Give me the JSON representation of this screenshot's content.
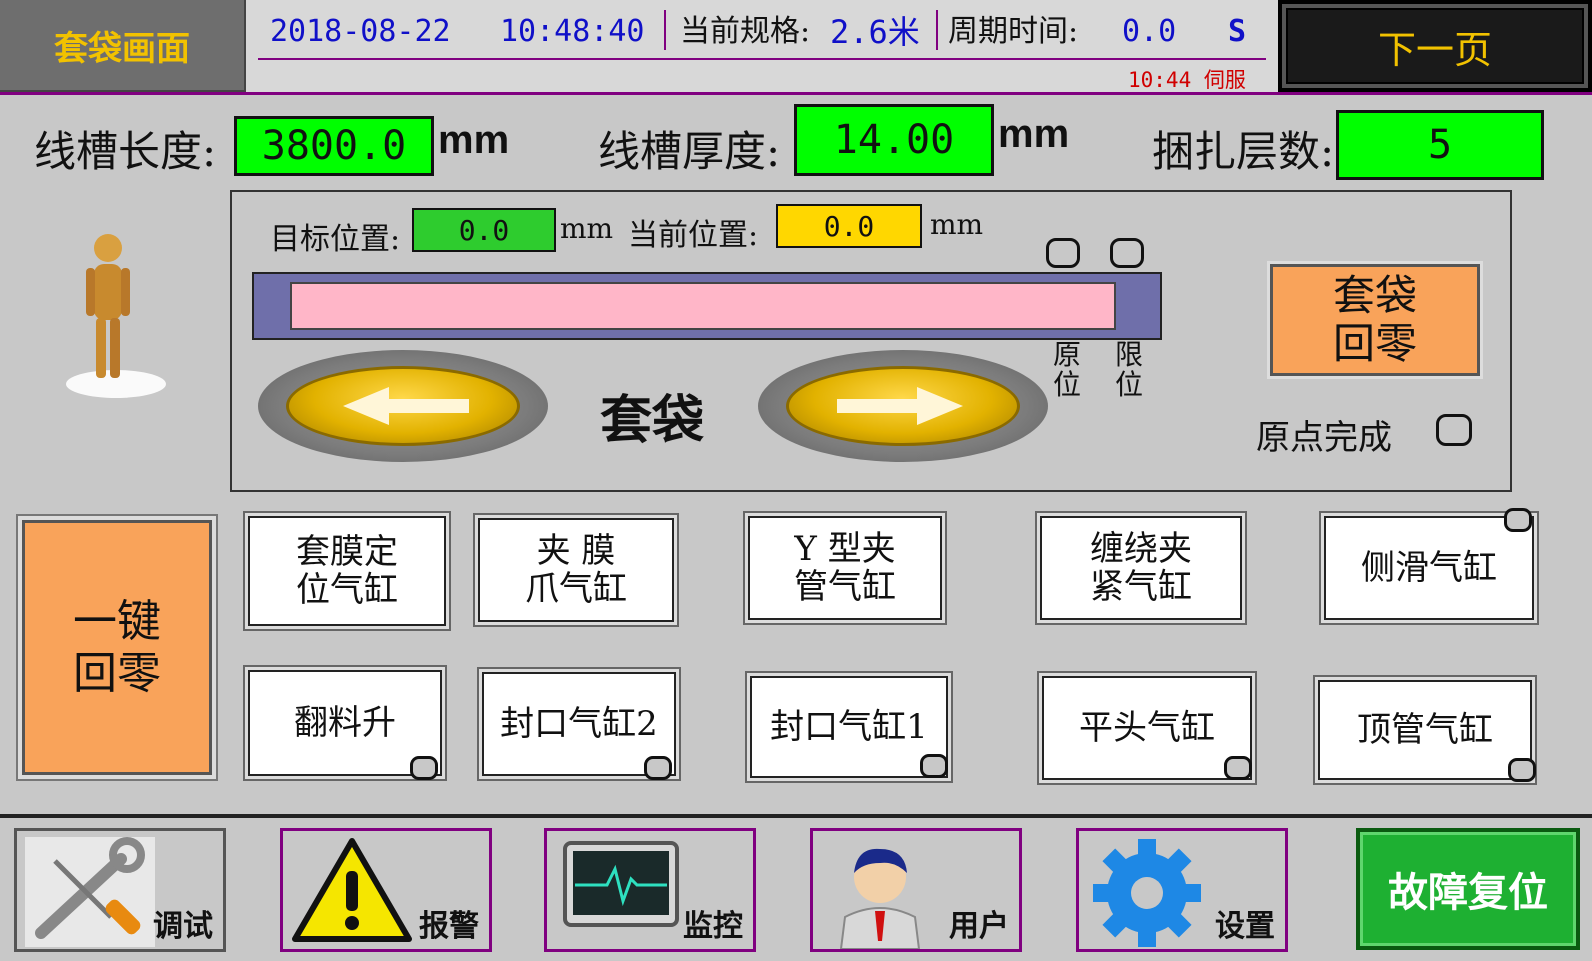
{
  "header": {
    "screen_title": "套袋画面",
    "date": "2018-08-22",
    "time": "10:48:40",
    "spec_label": "当前规格:",
    "spec_value": "2.6米",
    "cycle_label": "周期时间:",
    "cycle_value": "0.0",
    "cycle_unit": "S",
    "servo_message": "10:44 伺服",
    "next_page_label": "下一页"
  },
  "params": {
    "slot_length_label": "线槽长度:",
    "slot_length_value": "3800.0",
    "slot_length_unit": "mm",
    "slot_thickness_label": "线槽厚度:",
    "slot_thickness_value": "14.00",
    "slot_thickness_unit": "mm",
    "bind_layers_label": "捆扎层数:",
    "bind_layers_value": "5"
  },
  "position": {
    "target_label": "目标位置:",
    "target_value": "0.0",
    "target_unit": "mm",
    "current_label": "当前位置:",
    "current_value": "0.0",
    "current_unit": "mm",
    "origin_label": "原位",
    "limit_label": "限位",
    "jog_label": "套袋",
    "bag_zero_label_1": "套袋",
    "bag_zero_label_2": "回零",
    "origin_done_label": "原点完成"
  },
  "one_key_zero": {
    "line1": "一键",
    "line2": "回零"
  },
  "cylinders": {
    "row1": [
      {
        "line1": "套膜定",
        "line2": "位气缸"
      },
      {
        "line1": "夹  膜",
        "line2": "爪气缸"
      },
      {
        "line1": "Y 型夹",
        "line2": "管气缸"
      },
      {
        "line1": "缠绕夹",
        "line2": "紧气缸"
      },
      {
        "line1": "侧滑气缸",
        "line2": ""
      }
    ],
    "row2": [
      {
        "line1": "翻料升",
        "line2": ""
      },
      {
        "line1": "封口气缸2",
        "line2": ""
      },
      {
        "line1": "封口气缸1",
        "line2": ""
      },
      {
        "line1": "平头气缸",
        "line2": ""
      },
      {
        "line1": "顶管气缸",
        "line2": ""
      }
    ]
  },
  "nav": {
    "debug": "调试",
    "alarm": "报警",
    "monitor": "监控",
    "user": "用户",
    "settings": "设置",
    "fault_reset": "故障复位"
  },
  "colors": {
    "accent_purple": "#800080",
    "title_yellow": "#f2c200",
    "value_green": "#00ff00",
    "current_yellow": "#ffd700",
    "button_orange": "#f9a35a",
    "reset_green": "#1eb032"
  },
  "icons": [
    "person-figure-icon",
    "left-arrow-icon",
    "right-arrow-icon",
    "wrench-screwdriver-icon",
    "warning-triangle-icon",
    "heart-monitor-icon",
    "user-avatar-icon",
    "gear-icon"
  ]
}
